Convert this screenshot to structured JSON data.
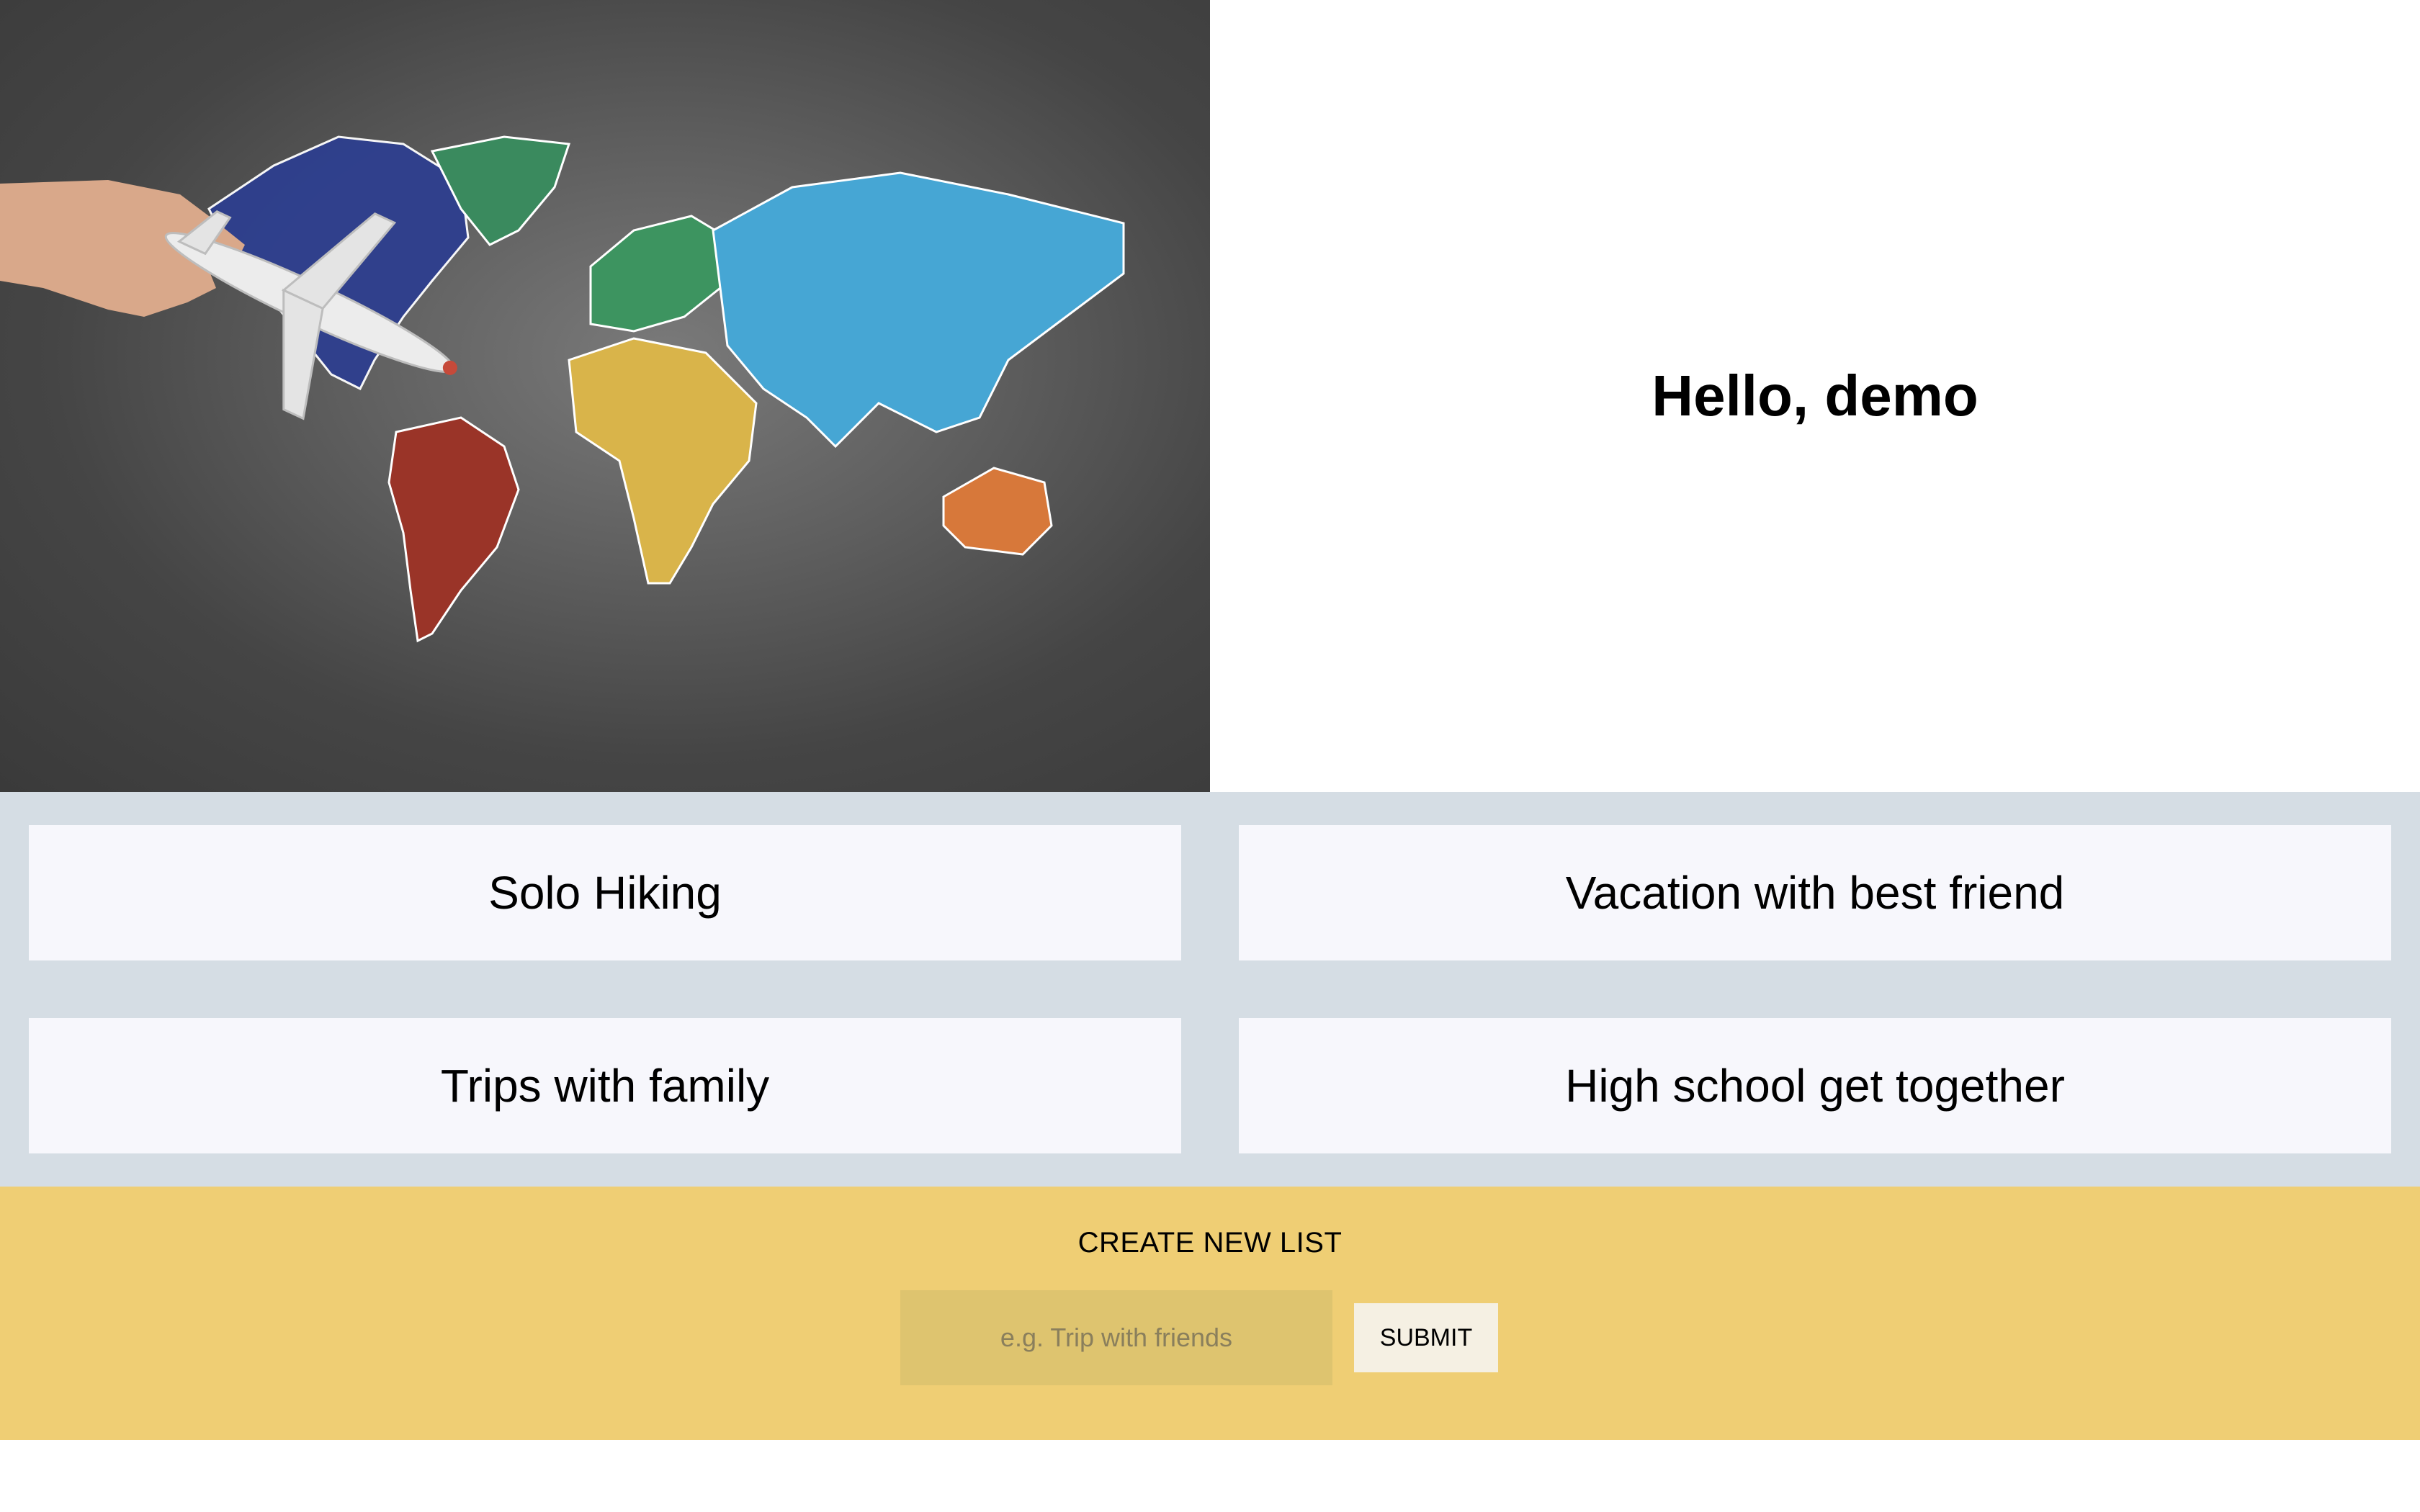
{
  "hero": {
    "image_alt": "Chalkboard world map with toy airplane",
    "greeting": "Hello, demo"
  },
  "lists": [
    {
      "label": "Solo Hiking"
    },
    {
      "label": "Vacation with best friend"
    },
    {
      "label": "Trips with family"
    },
    {
      "label": "High school get together"
    }
  ],
  "create": {
    "title": "CREATE NEW LIST",
    "input_placeholder": "e.g. Trip with friends",
    "submit_label": "SUBMIT"
  },
  "colors": {
    "lists_background": "#d5dde4",
    "card_background": "#f7f7fc",
    "create_background": "#efce74",
    "input_background": "#dec46f",
    "submit_background": "#f5f0e3"
  }
}
